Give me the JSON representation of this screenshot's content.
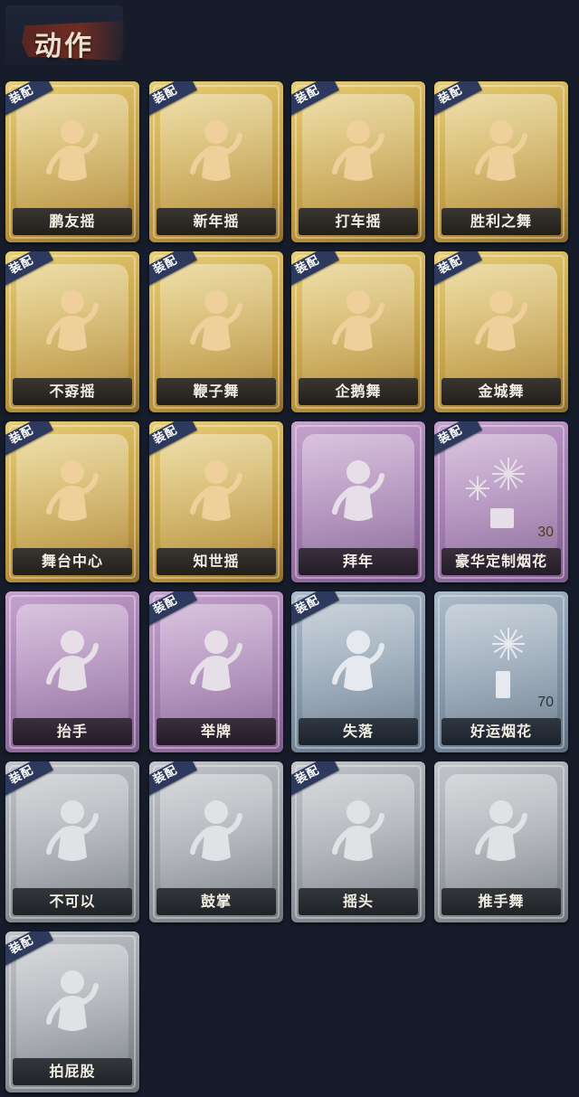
{
  "title": "动作",
  "equip_label": "装配",
  "cards": [
    {
      "label": "鹏友摇",
      "theme": "gold",
      "equipped": true,
      "icon": "dance-pose-icon"
    },
    {
      "label": "新年摇",
      "theme": "gold",
      "equipped": true,
      "icon": "dance-pose-icon"
    },
    {
      "label": "打车摇",
      "theme": "gold",
      "equipped": true,
      "icon": "dance-pose-icon"
    },
    {
      "label": "胜利之舞",
      "theme": "gold",
      "equipped": true,
      "icon": "dance-pose-icon"
    },
    {
      "label": "不孬摇",
      "theme": "gold",
      "equipped": true,
      "icon": "dance-pose-icon"
    },
    {
      "label": "鞭子舞",
      "theme": "gold",
      "equipped": true,
      "icon": "dance-pose-icon"
    },
    {
      "label": "企鹅舞",
      "theme": "gold",
      "equipped": true,
      "icon": "dance-pose-icon"
    },
    {
      "label": "金城舞",
      "theme": "gold",
      "equipped": true,
      "icon": "dance-pose-icon"
    },
    {
      "label": "舞台中心",
      "theme": "gold",
      "equipped": true,
      "icon": "dance-pose-icon"
    },
    {
      "label": "知世摇",
      "theme": "gold",
      "equipped": true,
      "icon": "dance-pose-icon"
    },
    {
      "label": "拜年",
      "theme": "purple",
      "equipped": false,
      "icon": "bow-pose-icon"
    },
    {
      "label": "豪华定制烟花",
      "theme": "purple",
      "equipped": true,
      "icon": "fireworks-icon",
      "count": "30"
    },
    {
      "label": "抬手",
      "theme": "purple",
      "equipped": false,
      "icon": "raise-hand-pose-icon"
    },
    {
      "label": "举牌",
      "theme": "purple",
      "equipped": true,
      "icon": "hold-sign-pose-icon"
    },
    {
      "label": "失落",
      "theme": "blue",
      "equipped": true,
      "icon": "crawl-pose-icon"
    },
    {
      "label": "好运烟花",
      "theme": "blue",
      "equipped": false,
      "icon": "firework-cracker-icon",
      "count": "70"
    },
    {
      "label": "不可以",
      "theme": "grey",
      "equipped": true,
      "icon": "finger-wag-icon"
    },
    {
      "label": "鼓掌",
      "theme": "grey",
      "equipped": true,
      "icon": "clap-hands-icon"
    },
    {
      "label": "摇头",
      "theme": "grey",
      "equipped": true,
      "icon": "shake-head-pose-icon"
    },
    {
      "label": "推手舞",
      "theme": "grey",
      "equipped": false,
      "icon": "push-hands-pose-icon"
    },
    {
      "label": "拍屁股",
      "theme": "grey",
      "equipped": true,
      "icon": "pat-butt-pose-icon"
    }
  ]
}
